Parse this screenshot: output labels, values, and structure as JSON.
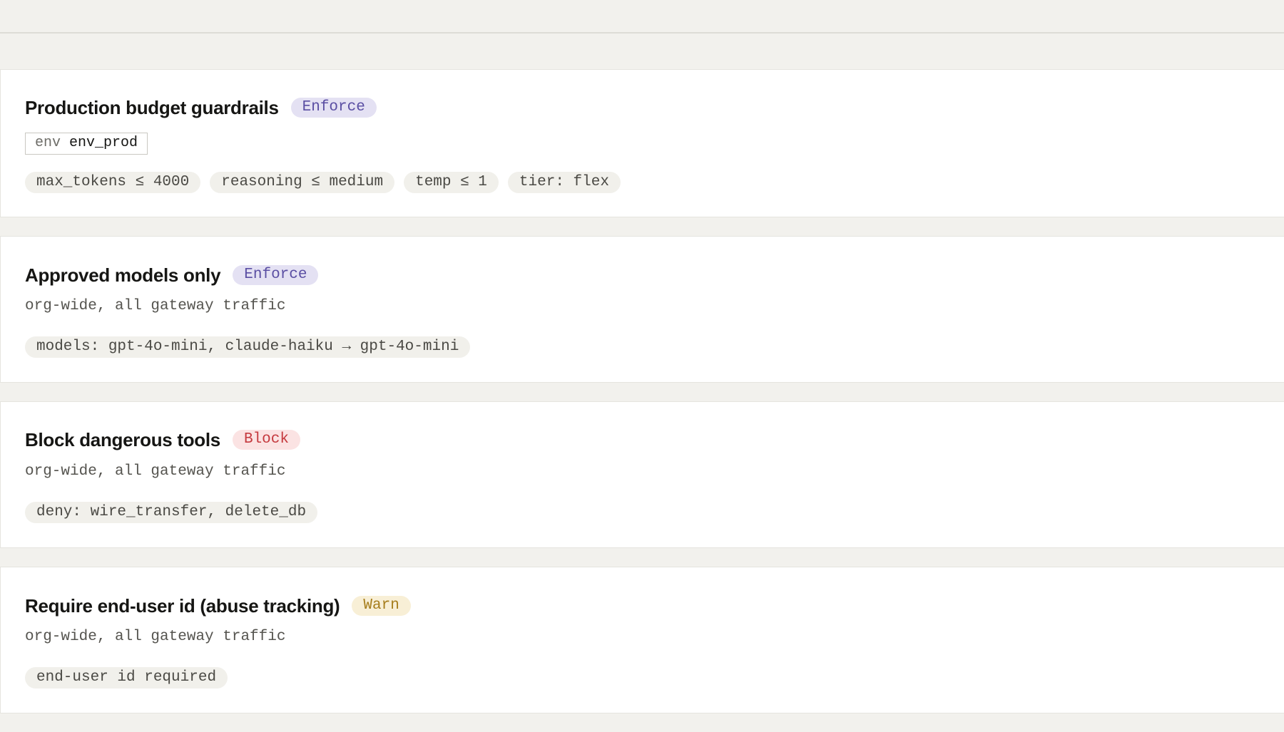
{
  "colors": {
    "page_background": "#f2f1ed",
    "card_background": "#ffffff",
    "chip_background": "#f1f0eb",
    "enforce_badge_bg": "#e4e1f3",
    "enforce_badge_text": "#5a4ea3",
    "block_badge_bg": "#fbe3e3",
    "block_badge_text": "#c53a3f",
    "warn_badge_bg": "#f8efd6",
    "warn_badge_text": "#a67d1b"
  },
  "policies": [
    {
      "title": "Production budget guardrails",
      "mode": "Enforce",
      "scope_key": "env",
      "scope_value": "env_prod",
      "rules": [
        "max_tokens ≤ 4000",
        "reasoning ≤ medium",
        "temp ≤ 1",
        "tier: flex"
      ]
    },
    {
      "title": "Approved models only",
      "mode": "Enforce",
      "scope": "org-wide, all gateway traffic",
      "rules": [
        "models: gpt-4o-mini, claude-haiku → gpt-4o-mini"
      ]
    },
    {
      "title": "Block dangerous tools",
      "mode": "Block",
      "scope": "org-wide, all gateway traffic",
      "rules": [
        "deny: wire_transfer, delete_db"
      ]
    },
    {
      "title": "Require end-user id (abuse tracking)",
      "mode": "Warn",
      "scope": "org-wide, all gateway traffic",
      "rules": [
        "end-user id required"
      ]
    }
  ]
}
